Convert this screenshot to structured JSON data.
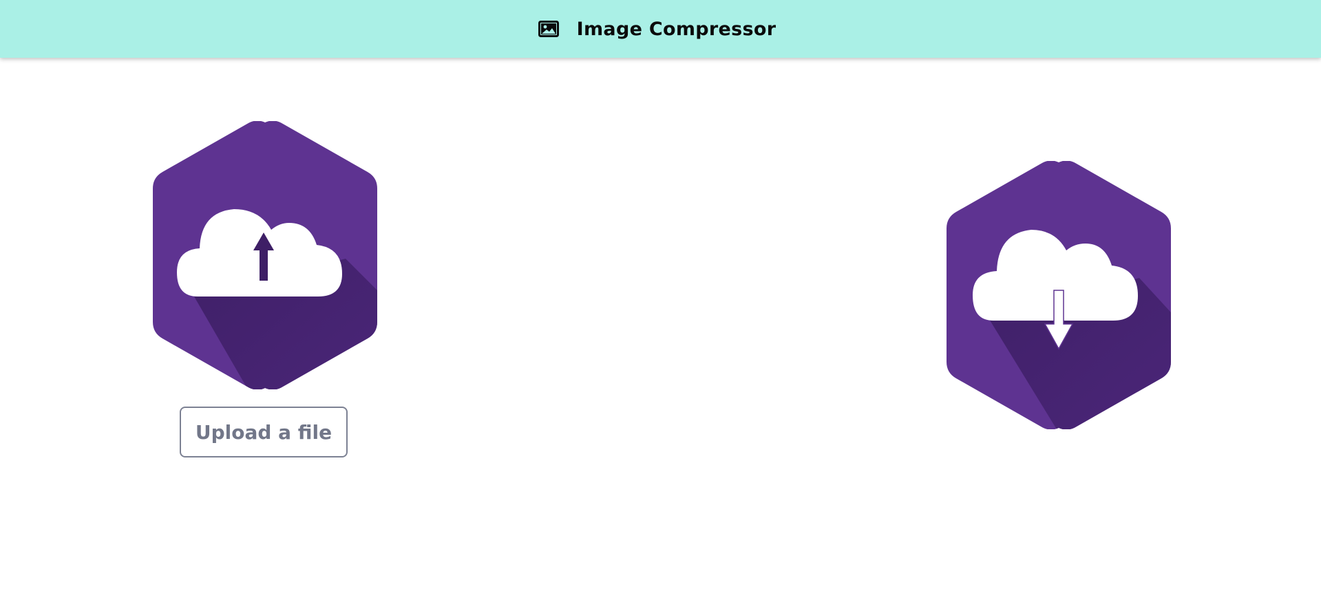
{
  "header": {
    "title": "Image Compressor",
    "icon": "image-icon",
    "background": "#aaf0e6"
  },
  "upload": {
    "icon": "cloud-upload-icon",
    "button_label": "Upload a file"
  },
  "download": {
    "icon": "cloud-download-icon"
  },
  "colors": {
    "hexagon": "#5e3391",
    "shadow": "#3e1f66",
    "cloud": "#ffffff",
    "button_border": "#7c8193",
    "button_text": "#727789"
  }
}
